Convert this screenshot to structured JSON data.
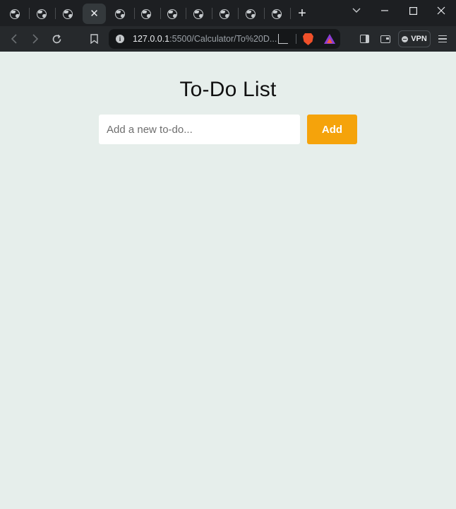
{
  "browser": {
    "tab_count": 11,
    "active_tab_index": 4,
    "new_tab_label": "+",
    "window": {
      "minimize": "—",
      "maximize": "☐",
      "close": "✕"
    },
    "url_host": "127.0.0.1",
    "url_rest": ":5500/Calculator/To%20D...",
    "vpn_label": "VPN",
    "colors": {
      "tabstrip": "#1d1f22",
      "toolbar": "#26292c",
      "omnibox": "#151719"
    }
  },
  "page": {
    "title": "To-Do List",
    "input_placeholder": "Add a new to-do...",
    "input_value": "",
    "add_label": "Add",
    "colors": {
      "background": "#e6eeeb",
      "accent": "#f5a30b"
    }
  }
}
